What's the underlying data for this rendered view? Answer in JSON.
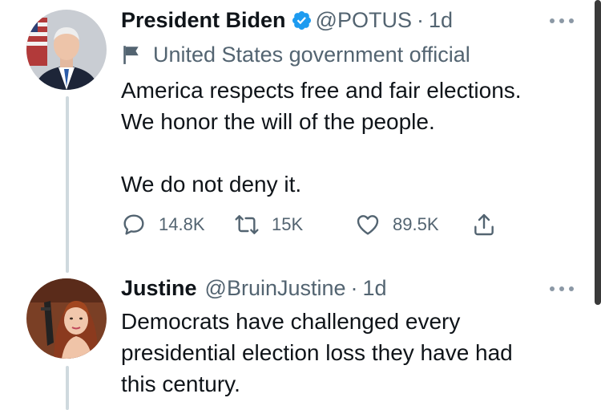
{
  "tweets": [
    {
      "display_name": "President Biden",
      "handle": "@POTUS",
      "separator": "·",
      "time": "1d",
      "verified": true,
      "label": "United States government official",
      "text_lines": [
        "America respects free and fair elections.",
        "We honor the will of the people.",
        "",
        "We do not deny it."
      ],
      "actions": {
        "reply_count": "14.8K",
        "retweet_count": "15K",
        "like_count": "89.5K"
      }
    },
    {
      "display_name": "Justine",
      "handle": "@BruinJustine",
      "separator": "·",
      "time": "1d",
      "verified": false,
      "text_lines": [
        "Democrats have challenged every",
        "presidential election loss they have had",
        "this century."
      ]
    }
  ],
  "icons": {
    "verified": "verified-badge-icon",
    "label": "flag-icon",
    "reply": "reply-icon",
    "retweet": "retweet-icon",
    "like": "heart-icon",
    "share": "share-icon",
    "more": "more-icon"
  },
  "colors": {
    "text": "#0f1419",
    "secondary": "#536471",
    "verified": "#1d9bf0",
    "thread_line": "#cfd9de"
  }
}
